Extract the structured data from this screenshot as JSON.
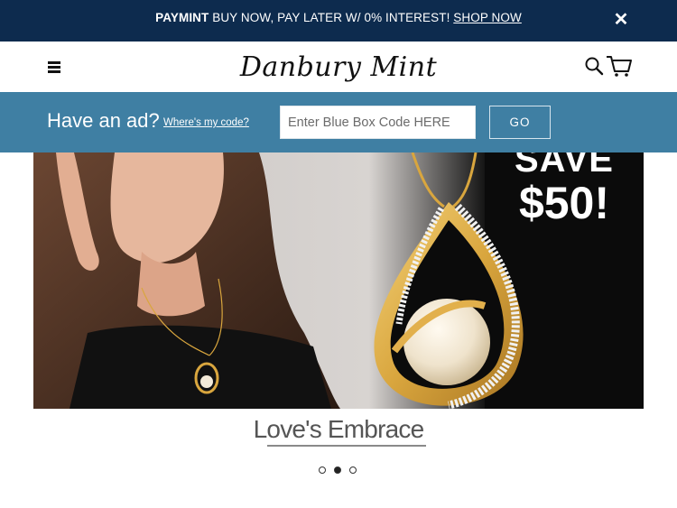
{
  "promo": {
    "brand": "PAYMINT",
    "message": " BUY NOW, PAY LATER W/ 0% INTEREST! ",
    "link": "SHOP NOW",
    "close_icon": "close-icon"
  },
  "header": {
    "logo_text": "Danbury Mint",
    "menu_icon": "hamburger-menu-icon",
    "search_icon": "search-icon",
    "cart_icon": "shopping-cart-icon"
  },
  "adbar": {
    "title": "Have an ad?",
    "link": "Where's my code?",
    "input_placeholder": "Enter Blue Box Code HERE",
    "button": "GO"
  },
  "hero": {
    "offer_line1": "SAVE",
    "offer_line2": "$50!",
    "caption": "Love's Embrace",
    "slides": 3,
    "active_slide": 2
  },
  "colors": {
    "promo_bg": "#0d2b4e",
    "adbar_bg": "#3f7fa3",
    "gold": "#d9a63e"
  }
}
